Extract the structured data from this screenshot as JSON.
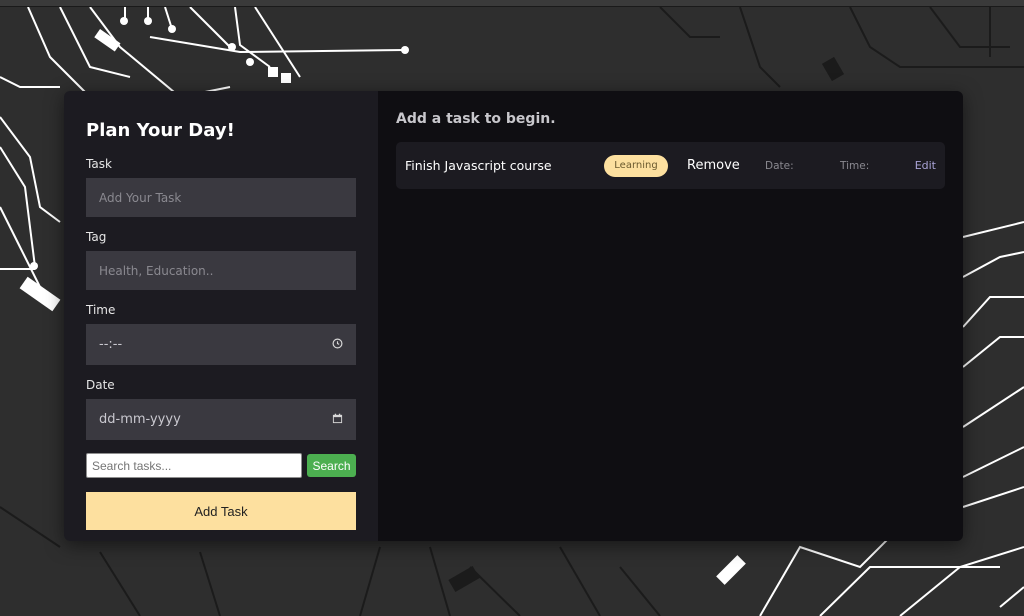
{
  "form": {
    "title": "Plan Your Day!",
    "task_label": "Task",
    "task_placeholder": "Add Your Task",
    "tag_label": "Tag",
    "tag_placeholder": "Health, Education..",
    "time_label": "Time",
    "time_value": "--:--",
    "date_label": "Date",
    "date_value": "dd-mm-yyyy",
    "search_placeholder": "Search tasks...",
    "search_button": "Search",
    "add_button": "Add Task"
  },
  "tasks_panel": {
    "status_text": "Add a task to begin.",
    "tasks": [
      {
        "name": "Finish Javascript course",
        "tag": "Learning",
        "remove_label": "Remove",
        "date_label": "Date:",
        "time_label": "Time:",
        "edit_label": "Edit"
      }
    ]
  },
  "colors": {
    "accent": "#fde09f",
    "search_button": "#4caf50",
    "panel_left": "#1c1b21",
    "panel_right": "#0f0e12",
    "background": "#2e2e2e"
  },
  "icons": [
    "clock-icon",
    "calendar-icon"
  ]
}
